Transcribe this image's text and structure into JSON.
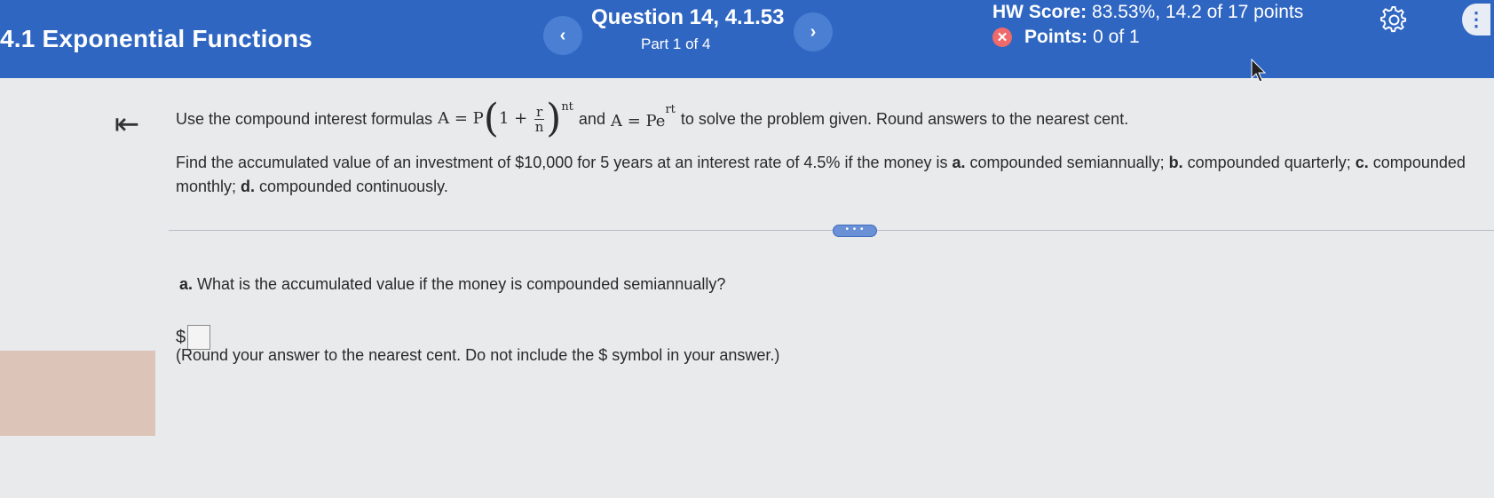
{
  "header": {
    "section_title": "4.1 Exponential Functions",
    "question_title": "Question 14, 4.1.53",
    "part_label": "Part 1 of 4",
    "hw_score_label": "HW Score:",
    "hw_score_value": "83.53%, 14.2 of 17 points",
    "points_label": "Points:",
    "points_value": "0 of 1",
    "prev_icon": "chevron-left",
    "next_icon": "chevron-right"
  },
  "instructions": {
    "prefix": "Use the compound interest formulas",
    "formula1_lhs": "A = P",
    "formula1_one": "1 +",
    "formula1_num": "r",
    "formula1_den": "n",
    "formula1_exp": "nt",
    "and_text": "and",
    "formula2_base": "A = Pe",
    "formula2_exp": "rt",
    "suffix": "to solve the problem given. Round answers to the nearest cent."
  },
  "problem": {
    "text1": "Find the accumulated value of an investment of $10,000 for 5 years at an interest rate of 4.5% if the money is ",
    "a_label": "a.",
    "a_text": " compounded semiannually; ",
    "b_label": "b.",
    "b_text": " compounded quarterly; ",
    "c_label": "c.",
    "c_text": " compounded monthly; ",
    "d_label": "d.",
    "d_text": " compounded continuously."
  },
  "divider_label": "• • •",
  "part_a": {
    "label": "a.",
    "question": " What is the accumulated value if the money is compounded semiannually?",
    "currency": "$",
    "answer_value": "",
    "hint": "(Round your answer to the nearest cent. Do not include the $ symbol in your answer.)"
  },
  "colors": {
    "header_bg": "#2f66c2",
    "page_bg": "#e9eaec",
    "incorrect_red": "#ef6a6a"
  }
}
